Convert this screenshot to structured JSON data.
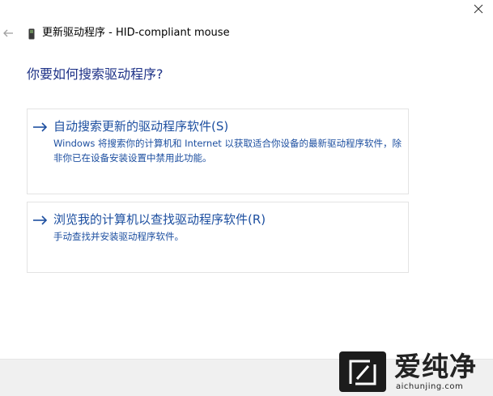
{
  "window": {
    "title": "更新驱动程序 - HID-compliant mouse",
    "back_icon": "back-arrow-icon",
    "close_icon": "close-icon",
    "device_icon": "device-icon"
  },
  "main": {
    "question": "你要如何搜索驱动程序?",
    "options": [
      {
        "title": "自动搜索更新的驱动程序软件(S)",
        "description": "Windows 将搜索你的计算机和 Internet 以获取适合你设备的最新驱动程序软件，除非你已在设备安装设置中禁用此功能。",
        "icon": "arrow-right-icon"
      },
      {
        "title": "浏览我的计算机以查找驱动程序软件(R)",
        "description": "手动查找并安装驱动程序软件。",
        "icon": "arrow-right-icon"
      }
    ]
  },
  "watermark": {
    "name": "爱纯净",
    "url": "aichunjing.com"
  },
  "colors": {
    "link": "#1d4fa0",
    "heading": "#1e3287",
    "footer_bg": "#f0f0f0",
    "logo_bg": "#1c1c1c"
  }
}
